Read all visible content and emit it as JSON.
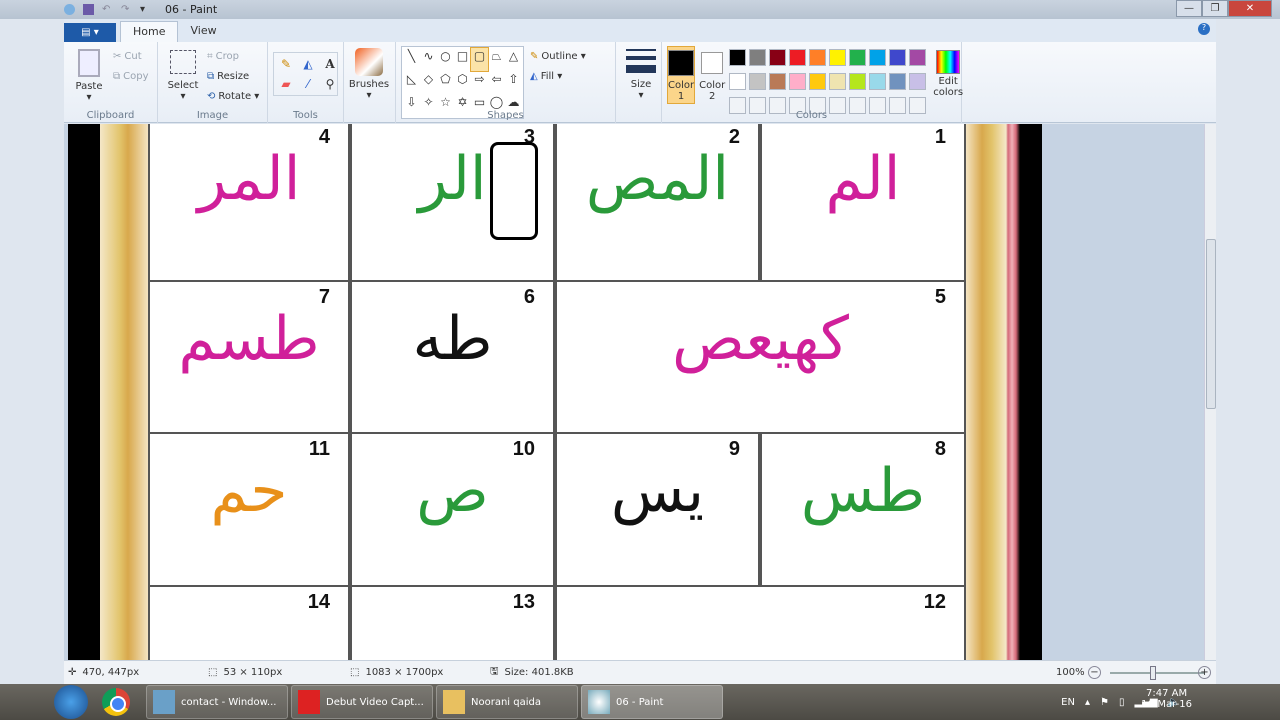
{
  "window": {
    "title": "06 - Paint",
    "minimize": "—",
    "maximize": "❐",
    "close": "✕"
  },
  "tabs": {
    "file": "▤ ▾",
    "home": "Home",
    "view": "View",
    "help": "?"
  },
  "ribbon": {
    "clipboard": {
      "label": "Clipboard",
      "paste": "Paste",
      "cut": "Cut",
      "copy": "Copy"
    },
    "image": {
      "label": "Image",
      "select": "Select",
      "crop": "Crop",
      "resize": "Resize",
      "rotate": "Rotate ▾"
    },
    "tools": {
      "label": "Tools"
    },
    "brushes": {
      "label": "Brushes"
    },
    "shapes": {
      "label": "Shapes",
      "outline": "Outline ▾",
      "fill": "Fill ▾",
      "glyphs": [
        "╲",
        "∿",
        "○",
        "□",
        "▢",
        "⏢",
        "△",
        "◺",
        "◇",
        "⬠",
        "⬡",
        "⇨",
        "⇦",
        "⇧",
        "⇩",
        "✧",
        "☆",
        "✡",
        "▭",
        "◯",
        "☁"
      ]
    },
    "size": {
      "label": "Size"
    },
    "colors": {
      "label": "Colors",
      "color1": "Color 1",
      "color2": "Color 2",
      "edit": "Edit colors",
      "color1_value": "#000000",
      "color2_value": "#ffffff",
      "palette": [
        "#000000",
        "#7f7f7f",
        "#880015",
        "#ed1c24",
        "#ff7f27",
        "#fff200",
        "#22b14c",
        "#00a2e8",
        "#3f48cc",
        "#a349a4",
        "#ffffff",
        "#c3c3c3",
        "#b97a57",
        "#ffaec9",
        "#ffc90e",
        "#efe4b0",
        "#b5e61d",
        "#99d9ea",
        "#7092be",
        "#c8bfe7"
      ]
    }
  },
  "canvas": {
    "cells": [
      {
        "num": "4",
        "text": "المر",
        "color": "#d0209a"
      },
      {
        "num": "3",
        "text": "الر",
        "color": "#2a9a3a"
      },
      {
        "num": "2",
        "text": "المص",
        "color": "#2a9a3a"
      },
      {
        "num": "1",
        "text": "الم",
        "color": "#d0209a"
      },
      {
        "num": "7",
        "text": "طسم",
        "color": "#d0209a"
      },
      {
        "num": "6",
        "text": "طه",
        "color": "#111111"
      },
      {
        "num": "5",
        "text": "كهيعص",
        "color": "#d0209a"
      },
      {
        "num": "11",
        "text": "حم",
        "color": "#e8901a"
      },
      {
        "num": "10",
        "text": "ص",
        "color": "#2a9a3a"
      },
      {
        "num": "9",
        "text": "يس",
        "color": "#111111"
      },
      {
        "num": "8",
        "text": "طس",
        "color": "#2a9a3a"
      },
      {
        "num": "14",
        "text": "",
        "color": "#e8901a"
      },
      {
        "num": "13",
        "text": "",
        "color": "#2a9a3a"
      },
      {
        "num": "12",
        "text": "",
        "color": "#d0209a"
      }
    ]
  },
  "status": {
    "cursor": "470, 447px",
    "selection": "53 × 110px",
    "canvas_size": "1083 × 1700px",
    "file_size": "Size: 401.8KB",
    "zoom": "100%",
    "zoom_level": 100
  },
  "taskbar": {
    "items": [
      "contact - Window...",
      "Debut Video Capt...",
      "Noorani qaida",
      "06 - Paint"
    ],
    "lang": "EN",
    "time": "7:47 AM",
    "date": "16-Mar-16"
  }
}
